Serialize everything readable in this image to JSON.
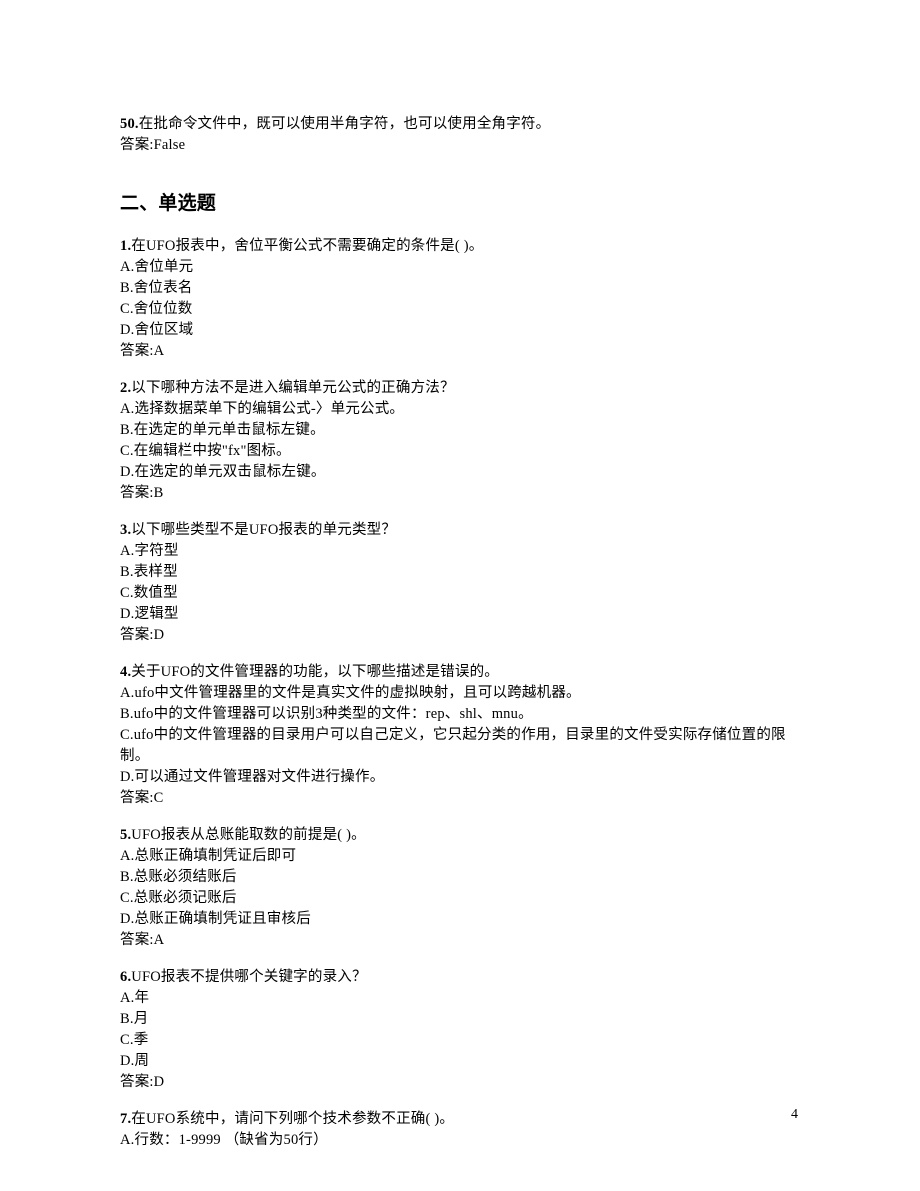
{
  "intro": {
    "q50": {
      "num": "50.",
      "text": "在批命令文件中，既可以使用半角字符，也可以使用全角字符。",
      "answer": "答案:False"
    }
  },
  "section_title": "二、单选题",
  "questions": [
    {
      "num": "1.",
      "stem": "在UFO报表中，舍位平衡公式不需要确定的条件是(   )。",
      "options": [
        "A.舍位单元",
        "B.舍位表名",
        "C.舍位位数",
        "D.舍位区域"
      ],
      "answer": "答案:A"
    },
    {
      "num": "2.",
      "stem": "以下哪种方法不是进入编辑单元公式的正确方法？",
      "options": [
        "A.选择数据菜单下的编辑公式-〉单元公式。",
        "B.在选定的单元单击鼠标左键。",
        "C.在编辑栏中按\"fx\"图标。",
        "D.在选定的单元双击鼠标左键。"
      ],
      "answer": "答案:B"
    },
    {
      "num": "3.",
      "stem": "以下哪些类型不是UFO报表的单元类型？",
      "options": [
        "A.字符型",
        "B.表样型",
        "C.数值型",
        "D.逻辑型"
      ],
      "answer": "答案:D"
    },
    {
      "num": "4.",
      "stem": "关于UFO的文件管理器的功能，以下哪些描述是错误的。",
      "options": [
        "A.ufo中文件管理器里的文件是真实文件的虚拟映射，且可以跨越机器。",
        "B.ufo中的文件管理器可以识别3种类型的文件：rep、shl、mnu。",
        "C.ufo中的文件管理器的目录用户可以自己定义，它只起分类的作用，目录里的文件受实际存储位置的限制。",
        "D.可以通过文件管理器对文件进行操作。"
      ],
      "answer": "答案:C"
    },
    {
      "num": "5.",
      "stem": "UFO报表从总账能取数的前提是(   )。",
      "options": [
        "A.总账正确填制凭证后即可",
        "B.总账必须结账后",
        "C.总账必须记账后",
        "D.总账正确填制凭证且审核后"
      ],
      "answer": "答案:A"
    },
    {
      "num": "6.",
      "stem": "UFO报表不提供哪个关键字的录入？",
      "options": [
        "A.年",
        "B.月",
        "C.季",
        "D.周"
      ],
      "answer": "答案:D"
    },
    {
      "num": "7.",
      "stem": "在UFO系统中，请问下列哪个技术参数不正确(    )。",
      "options": [
        "A.行数：1-9999  （缺省为50行）"
      ],
      "answer": ""
    }
  ],
  "page_number": "4"
}
